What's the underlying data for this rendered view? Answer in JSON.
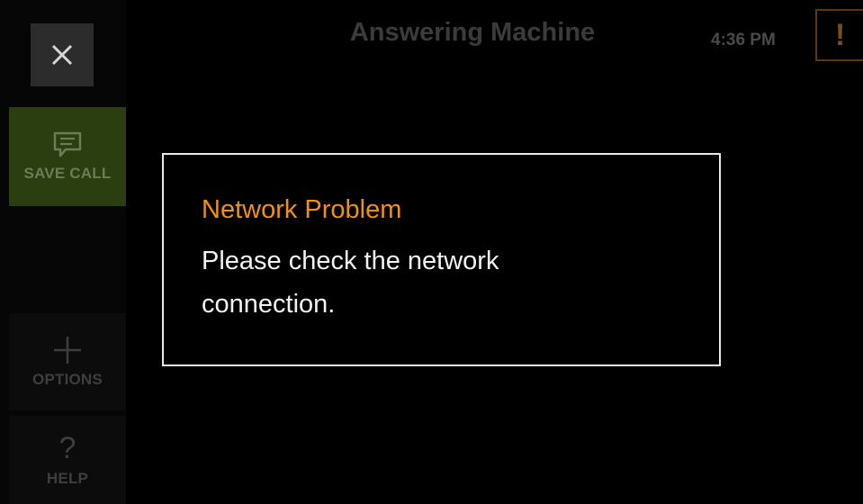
{
  "header": {
    "title": "Answering Machine",
    "time": "4:36 PM",
    "alert_icon": "exclamation-icon",
    "alert_glyph": "!"
  },
  "sidebar": {
    "close_icon": "close-icon",
    "items": [
      {
        "label": "SAVE CALL",
        "icon": "message-icon"
      },
      {
        "label": "OPTIONS",
        "icon": "plus-icon"
      },
      {
        "label": "HELP",
        "icon": "question-icon",
        "glyph": "?"
      }
    ]
  },
  "dialog": {
    "title": "Network Problem",
    "message": "Please check the network connection."
  },
  "colors": {
    "background": "#000000",
    "accent_orange": "#f2920a",
    "save_call_bg": "#2a3e0f",
    "dialog_border": "#e9e9e9"
  }
}
